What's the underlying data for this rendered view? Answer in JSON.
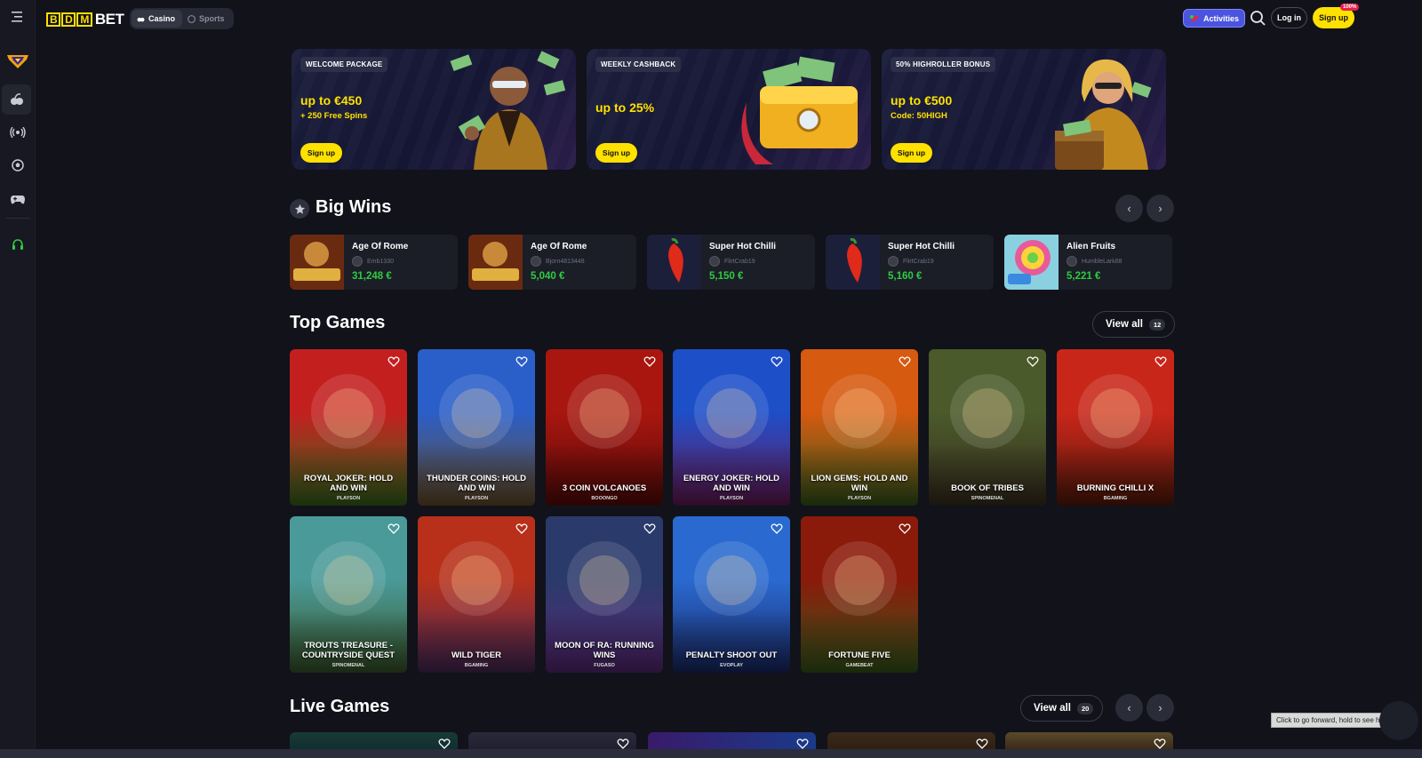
{
  "brand": {
    "logo_b": "B",
    "logo_d": "D",
    "logo_m": "M",
    "logo_bet": "BET"
  },
  "topbar": {
    "casino_label": "Casino",
    "sports_label": "Sports",
    "activities_label": "Activities",
    "login_label": "Log in",
    "signup_label": "Sign up",
    "signup_badge": "100%"
  },
  "promos": [
    {
      "tag": "WELCOME PACKAGE",
      "amount": "up to €450",
      "sub": "+ 250 Free Spins",
      "cta": "Sign up"
    },
    {
      "tag": "WEEKLY CASHBACK",
      "amount": "up to 25%",
      "sub": "",
      "cta": "Sign up"
    },
    {
      "tag": "50% HIGHROLLER BONUS",
      "amount": "up to €500",
      "sub": "Code: 50HIGH",
      "cta": "Sign up"
    }
  ],
  "big_wins": {
    "title": "Big Wins",
    "items": [
      {
        "game": "Age Of Rome",
        "player": "Emb1330",
        "amount": "31,248 €"
      },
      {
        "game": "Age Of Rome",
        "player": "Bjorn4813448",
        "amount": "5,040 €"
      },
      {
        "game": "Super Hot Chilli",
        "player": "FlirtCrab19",
        "amount": "5,150 €"
      },
      {
        "game": "Super Hot Chilli",
        "player": "FlirtCrab19",
        "amount": "5,160 €"
      },
      {
        "game": "Alien Fruits",
        "player": "HumbleLark88",
        "amount": "5,221 €"
      }
    ]
  },
  "top_games": {
    "title": "Top Games",
    "view_all": "View all",
    "count": "12",
    "games": [
      {
        "title": "ROYAL JOKER: HOLD AND WIN",
        "provider": "PLAYSON",
        "c1": "#c41f1f",
        "c2": "#3a6b1d"
      },
      {
        "title": "THUNDER COINS: HOLD AND WIN",
        "provider": "PLAYSON",
        "c1": "#2a5ec9",
        "c2": "#6b4f2a"
      },
      {
        "title": "3 COIN VOLCANOES",
        "provider": "BOOONGO",
        "c1": "#a8160f",
        "c2": "#5a0a08"
      },
      {
        "title": "ENERGY JOKER: HOLD AND WIN",
        "provider": "PLAYSON",
        "c1": "#1d4fc9",
        "c2": "#6a1a5a"
      },
      {
        "title": "LION GEMS: HOLD AND WIN",
        "provider": "PLAYSON",
        "c1": "#d65a10",
        "c2": "#3a5a1a"
      },
      {
        "title": "BOOK OF TRIBES",
        "provider": "SPINOMENAL",
        "c1": "#4a5a2a",
        "c2": "#3a3020"
      },
      {
        "title": "BURNING CHILLI X",
        "provider": "BGAMING",
        "c1": "#c9261a",
        "c2": "#5a1a0a"
      },
      {
        "title": "TROUTS TREASURE - COUNTRYSIDE QUEST",
        "provider": "SPINOMENAL",
        "c1": "#4a9a9a",
        "c2": "#3a5a2a"
      },
      {
        "title": "WILD TIGER",
        "provider": "BGAMING",
        "c1": "#b8301a",
        "c2": "#4a2a5a"
      },
      {
        "title": "MOON OF RA: RUNNING WINS",
        "provider": "FUGASO",
        "c1": "#2a3a6a",
        "c2": "#5a2a7a"
      },
      {
        "title": "PENALTY SHOOT OUT",
        "provider": "EVOPLAY",
        "c1": "#2a6ad0",
        "c2": "#1a2a6a"
      },
      {
        "title": "FORTUNE FIVE",
        "provider": "GAMEBEAT",
        "c1": "#8a1a0a",
        "c2": "#3a5a1a"
      }
    ]
  },
  "live_games": {
    "title": "Live Games",
    "view_all": "View all",
    "count": "20"
  },
  "tooltip": "Click to go forward, hold to see history"
}
